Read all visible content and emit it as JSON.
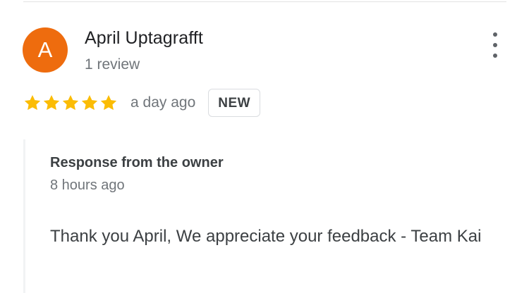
{
  "review": {
    "avatar_letter": "A",
    "avatar_color": "#ee6c0e",
    "reviewer_name": "April Uptagrafft",
    "review_count": "1 review",
    "rating": 5,
    "rating_max": 5,
    "star_color": "#fbbc04",
    "time": "a day ago",
    "badge": "NEW",
    "menu_icon": "more-vert-icon"
  },
  "owner_response": {
    "title": "Response from the owner",
    "time": "8 hours ago",
    "text": "Thank you April, We appreciate your feedback - Team Kai"
  }
}
